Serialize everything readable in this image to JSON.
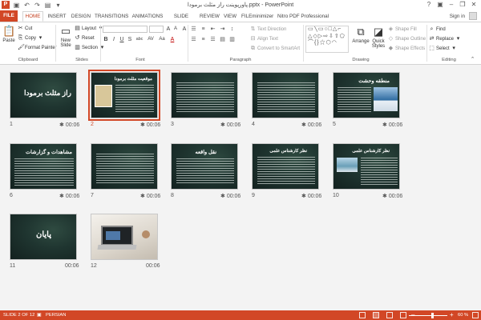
{
  "titlebar": {
    "title": "پاورپوینت راز مثلث برمودا.pptx - PowerPoint",
    "help": "?",
    "logo": "P"
  },
  "tabs": [
    "FILE",
    "HOME",
    "INSERT",
    "DESIGN",
    "TRANSITIONS",
    "ANIMATIONS",
    "SLIDE SHOW",
    "REVIEW",
    "VIEW",
    "FILEminimizer",
    "Nitro PDF Professional"
  ],
  "signin": "Sign in",
  "ribbon": {
    "clipboard": {
      "paste": "Paste",
      "cut": "Cut",
      "copy": "Copy",
      "format_painter": "Format Painter",
      "label": "Clipboard"
    },
    "slides": {
      "new_slide_1": "New",
      "new_slide_2": "Slide",
      "layout": "Layout",
      "reset": "Reset",
      "section": "Section",
      "label": "Slides"
    },
    "font": {
      "label": "Font",
      "bold": "B",
      "italic": "I",
      "underline": "U",
      "strike": "S",
      "shadow": "abc",
      "spacing": "AV",
      "case": "Aa",
      "color": "A",
      "grow": "A",
      "shrink": "A",
      "clear": "A"
    },
    "paragraph": {
      "text_direction": "Text Direction",
      "align_text": "Align Text",
      "convert_smartart": "Convert to SmartArt",
      "label": "Paragraph"
    },
    "drawing": {
      "arrange": "Arrange",
      "quick_styles_1": "Quick",
      "quick_styles_2": "Styles",
      "shape_fill": "Shape Fill",
      "shape_outline": "Shape Outline",
      "shape_effects": "Shape Effects",
      "label": "Drawing",
      "shapes_preview": "▭\\ ▭○□△⌐⊓\n△◇▷⇨⇩⇧⊕⬠\n⌒{}☆⬡"
    },
    "editing": {
      "find": "Find",
      "replace": "Replace",
      "select": "Select",
      "label": "Editing"
    }
  },
  "slides": [
    {
      "num": "1",
      "time": "00:06",
      "title": "راز مثلث برمودا"
    },
    {
      "num": "2",
      "time": "00:06",
      "title": "موقعیت مثلث برمودا"
    },
    {
      "num": "3",
      "time": "00:06",
      "title": ""
    },
    {
      "num": "4",
      "time": "00:06",
      "title": ""
    },
    {
      "num": "5",
      "time": "00:06",
      "title": "منطقه وحشت"
    },
    {
      "num": "6",
      "time": "00:06",
      "title": "مشاهدات و گزارشات"
    },
    {
      "num": "7",
      "time": "00:06",
      "title": ""
    },
    {
      "num": "8",
      "time": "00:06",
      "title": "نقل واقعه"
    },
    {
      "num": "9",
      "time": "00:06",
      "title": "نظر کارشناس علمی"
    },
    {
      "num": "10",
      "time": "00:06",
      "title": "نظر کارشناس علمی"
    },
    {
      "num": "11",
      "time": "00:06",
      "title": "پایان"
    },
    {
      "num": "12",
      "time": "00:06",
      "title": ""
    }
  ],
  "status": {
    "slide_of": "SLIDE 2 OF 12",
    "language": "PERSIAN",
    "zoom": "60 %",
    "zoom_level": 0.6
  },
  "colors": {
    "accent": "#d24726",
    "slide_bg": "#1f3530"
  }
}
